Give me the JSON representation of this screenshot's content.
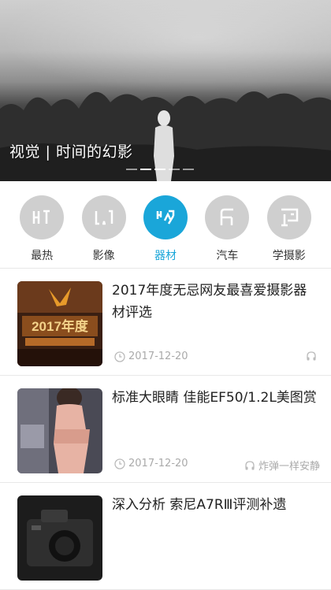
{
  "banner": {
    "title": "视觉 | 时间的幻影",
    "dots": [
      false,
      true,
      true,
      false,
      false
    ]
  },
  "categories": [
    {
      "label": "最热",
      "active": false,
      "icon": "hot-icon"
    },
    {
      "label": "影像",
      "active": false,
      "icon": "image-icon"
    },
    {
      "label": "器材",
      "active": true,
      "icon": "equipment-icon"
    },
    {
      "label": "汽车",
      "active": false,
      "icon": "car-icon"
    },
    {
      "label": "学摄影",
      "active": false,
      "icon": "learn-photography-icon"
    }
  ],
  "articles": [
    {
      "title": "2017年度无忌网友最喜爱摄影器材评选",
      "date": "2017-12-20",
      "author": "",
      "thumb_text": "2017年度"
    },
    {
      "title": "标准大眼睛 佳能EF50/1.2L美图赏",
      "date": "2017-12-20",
      "author": "炸弹一样安静"
    },
    {
      "title": "深入分析 索尼A7RⅢ评测补遗",
      "date": "",
      "author": ""
    }
  ],
  "colors": {
    "accent": "#1aa6d9",
    "inactive_icon": "#cfcfcf"
  }
}
